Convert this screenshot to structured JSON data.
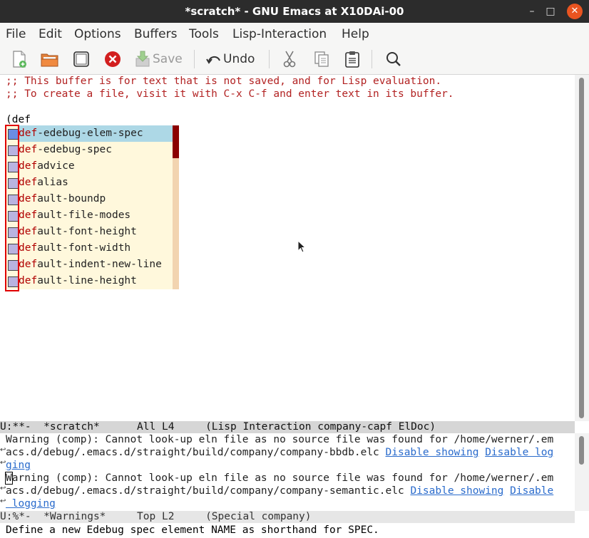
{
  "window": {
    "title": "*scratch* - GNU Emacs at X10DAi-00",
    "minimize_glyph": "–",
    "maximize_glyph": "□",
    "close_glyph": "✕"
  },
  "menubar": [
    "File",
    "Edit",
    "Options",
    "Buffers",
    "Tools",
    "Lisp-Interaction",
    "Help"
  ],
  "toolbar": {
    "save_label": "Save",
    "undo_label": "Undo",
    "icons": [
      "new-file-icon",
      "open-folder-icon",
      "dired-icon",
      "close-buffer-icon",
      "save-icon",
      "undo-icon",
      "cut-icon",
      "copy-icon",
      "paste-icon",
      "search-icon"
    ]
  },
  "editor": {
    "comment_lines": [
      ";; This buffer is for text that is not saved, and for Lisp evaluation.",
      ";; To create a file, visit it with C-x C-f and enter text in its buffer."
    ],
    "input_line": "(def",
    "completion": {
      "candidates": [
        {
          "match": "def",
          "rest": "-edebug-elem-spec"
        },
        {
          "match": "def",
          "rest": "-edebug-spec"
        },
        {
          "match": "def",
          "rest": "advice"
        },
        {
          "match": "def",
          "rest": "alias"
        },
        {
          "match": "def",
          "rest": "ault-boundp"
        },
        {
          "match": "def",
          "rest": "ault-file-modes"
        },
        {
          "match": "def",
          "rest": "ault-font-height"
        },
        {
          "match": "def",
          "rest": "ault-font-width"
        },
        {
          "match": "def",
          "rest": "ault-indent-new-line"
        },
        {
          "match": "def",
          "rest": "ault-line-height"
        }
      ],
      "selected_index": 0
    }
  },
  "modeline_scratch": "U:**-  *scratch*      All L4     (Lisp Interaction company-capf ElDoc)",
  "warnings": {
    "line1": "Warning (comp): Cannot look-up eln file as no source file was found for /home/werner/.em",
    "line2_text": "acs.d/debug/.emacs.d/straight/build/company/company-bbdb.elc ",
    "line2_link1": "Disable showing",
    "line2_link2": "Disable log",
    "line3_link": "ging",
    "line4_first": "W",
    "line4_rest": "arning (comp): Cannot look-up eln file as no source file was found for /home/werner/.em",
    "line5_text": "acs.d/debug/.emacs.d/straight/build/company/company-semantic.elc ",
    "line5_link1": "Disable showing",
    "line5_link2": "Disable",
    "line6_link": " logging"
  },
  "modeline_warnings": "U:%*-  *Warnings*     Top L2     (Special company)",
  "echo_area": "Define a new Edebug spec element NAME as shorthand for SPEC."
}
